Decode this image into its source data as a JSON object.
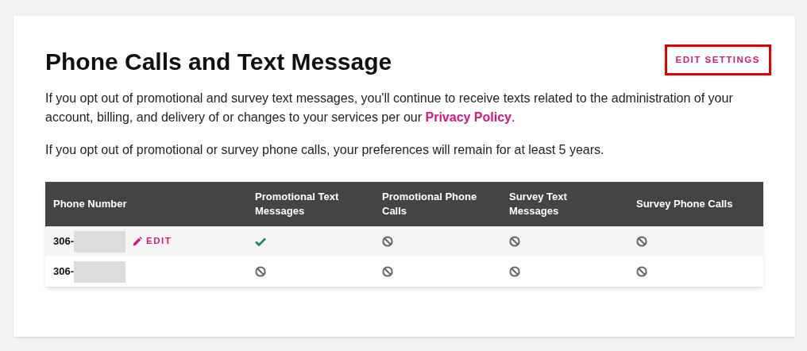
{
  "title": "Phone Calls and Text Message",
  "edit_settings": "EDIT SETTINGS",
  "paragraphs": [
    {
      "text": "If you opt out of promotional and survey text messages, you'll continue to receive texts related to the administration of your account, billing, and delivery of or changes to your services per our",
      "link": "Privacy Policy",
      "after": "."
    },
    {
      "text": "If you opt out of promotional or survey phone calls, your preferences will remain for at least 5 years."
    }
  ],
  "table": {
    "columns": [
      "Phone Number",
      "Promotional Text Messages",
      "Promotional Phone Calls",
      "Survey Text Messages",
      "Survey Phone Calls"
    ],
    "rows": [
      {
        "phone": "306-",
        "edit": "EDIT",
        "opted_in": [
          true,
          false,
          false,
          false
        ]
      },
      {
        "phone": "306-",
        "opted_in": [
          false,
          false,
          false,
          false
        ]
      }
    ]
  }
}
